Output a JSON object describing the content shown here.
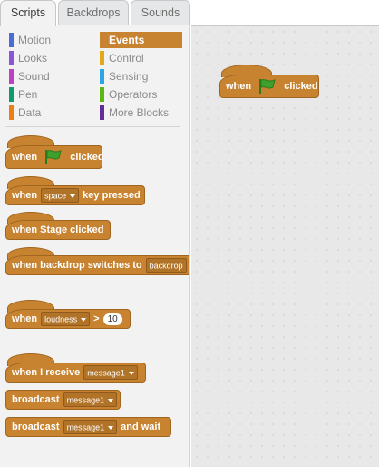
{
  "tabs": [
    {
      "label": "Scripts"
    },
    {
      "label": "Backdrops"
    },
    {
      "label": "Sounds"
    }
  ],
  "categories": [
    {
      "label": "Motion",
      "color": "#4a6cd4"
    },
    {
      "label": "Events",
      "color": "#c88330"
    },
    {
      "label": "Looks",
      "color": "#8a55d7"
    },
    {
      "label": "Control",
      "color": "#e1a91a"
    },
    {
      "label": "Sound",
      "color": "#bb42c3"
    },
    {
      "label": "Sensing",
      "color": "#2ca5e2"
    },
    {
      "label": "Pen",
      "color": "#0e9a6c"
    },
    {
      "label": "Operators",
      "color": "#5cb712"
    },
    {
      "label": "Data",
      "color": "#ee7d16"
    },
    {
      "label": "More Blocks",
      "color": "#632d99"
    }
  ],
  "selected_category": "Events",
  "palette_blocks": {
    "flag_when": "when",
    "flag_clicked": "clicked",
    "key_when": "when",
    "key_value": "space",
    "key_pressed": "key pressed",
    "stage_clicked": "when Stage clicked",
    "backdrop_switches": "when backdrop switches to",
    "backdrop_value": "backdrop",
    "loudness_when": "when",
    "loudness_value": "loudness",
    "loudness_op": ">",
    "loudness_threshold": "10",
    "receive_label": "when I receive",
    "receive_value": "message1",
    "broadcast_label": "broadcast",
    "broadcast_value": "message1",
    "broadcast_wait_label": "broadcast",
    "broadcast_wait_value": "message1",
    "broadcast_wait_suffix": "and wait"
  },
  "script_area": {
    "block_when": "when",
    "block_clicked": "clicked"
  },
  "colors": {
    "events": "#c88330",
    "flag_green": "#3fa02b"
  }
}
